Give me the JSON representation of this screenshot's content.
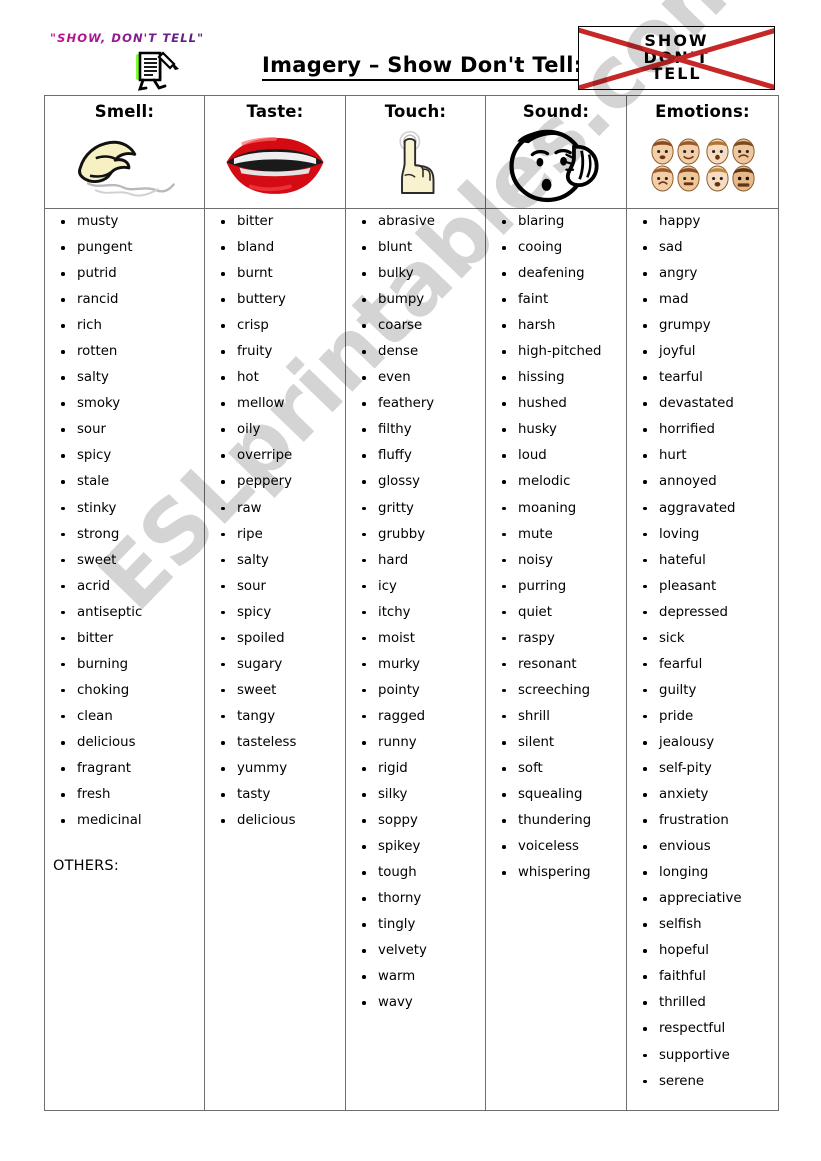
{
  "header": {
    "kicker": "\"SHOW, DON'T TELL\"",
    "title": "Imagery – Show Don't Tell:",
    "crossed_badge": {
      "line1": "SHOW",
      "line2": "DON'T",
      "line3": "TELL",
      "cross_color": "#cc2222"
    },
    "kicker_color": "#7b1b8d",
    "paper_icon": "running-paper-pencil-icon"
  },
  "watermark": {
    "text": "ESLprintables.com"
  },
  "table": {
    "columns": [
      {
        "key": "smell",
        "header": "Smell:",
        "icon": "nose-smelling-icon",
        "words": [
          "musty",
          "pungent",
          "putrid",
          "rancid",
          "rich",
          "rotten",
          "salty",
          "smoky",
          "sour",
          "spicy",
          "stale",
          "stinky",
          "strong",
          "sweet",
          "acrid",
          "antiseptic",
          "bitter",
          "burning",
          "choking",
          "clean",
          "delicious",
          "fragrant",
          "fresh",
          "medicinal"
        ],
        "footer": "OTHERS:"
      },
      {
        "key": "taste",
        "header": "Taste:",
        "icon": "red-lips-icon",
        "words": [
          "bitter",
          "bland",
          "burnt",
          "buttery",
          "crisp",
          "fruity",
          "hot",
          "mellow",
          "oily",
          "overripe",
          "peppery",
          "raw",
          "ripe",
          "salty",
          "sour",
          "spicy",
          "spoiled",
          "sugary",
          "sweet",
          "tangy",
          "tasteless",
          "yummy",
          "tasty",
          "delicious"
        ],
        "footer": ""
      },
      {
        "key": "touch",
        "header": "Touch:",
        "icon": "pointing-hand-icon",
        "words": [
          "abrasive",
          "blunt",
          "bulky",
          "bumpy",
          "coarse",
          "dense",
          "even",
          "feathery",
          "filthy",
          "fluffy",
          "glossy",
          "gritty",
          "grubby",
          "hard",
          "icy",
          "itchy",
          "moist",
          "murky",
          "pointy",
          "ragged",
          "runny",
          "rigid",
          "silky",
          "soppy",
          "spikey",
          "tough",
          "thorny",
          "tingly",
          "velvety",
          "warm",
          "wavy"
        ],
        "footer": ""
      },
      {
        "key": "sound",
        "header": "Sound:",
        "icon": "face-listening-icon",
        "words": [
          "blaring",
          "cooing",
          "deafening",
          "faint",
          "harsh",
          "high-pitched",
          "hissing",
          "hushed",
          "husky",
          "loud",
          "melodic",
          "moaning",
          "mute",
          "noisy",
          "purring",
          "quiet",
          "raspy",
          "resonant",
          "screeching",
          "shrill",
          "silent",
          "soft",
          "squealing",
          "thundering",
          "voiceless",
          "whispering"
        ],
        "footer": ""
      },
      {
        "key": "emotions",
        "header": "Emotions:",
        "icon": "emotion-faces-grid-icon",
        "words": [
          "happy",
          "sad",
          "angry",
          "mad",
          "grumpy",
          "joyful",
          "tearful",
          "devastated",
          "horrified",
          "hurt",
          "annoyed",
          "aggravated",
          "loving",
          "hateful",
          "pleasant",
          "depressed",
          "sick",
          "fearful",
          "guilty",
          "pride",
          "jealousy",
          "self-pity",
          "anxiety",
          "frustration",
          "envious",
          "longing",
          "appreciative",
          "selfish",
          "hopeful",
          "faithful",
          "thrilled",
          "respectful",
          "supportive",
          "serene"
        ],
        "footer": ""
      }
    ]
  }
}
